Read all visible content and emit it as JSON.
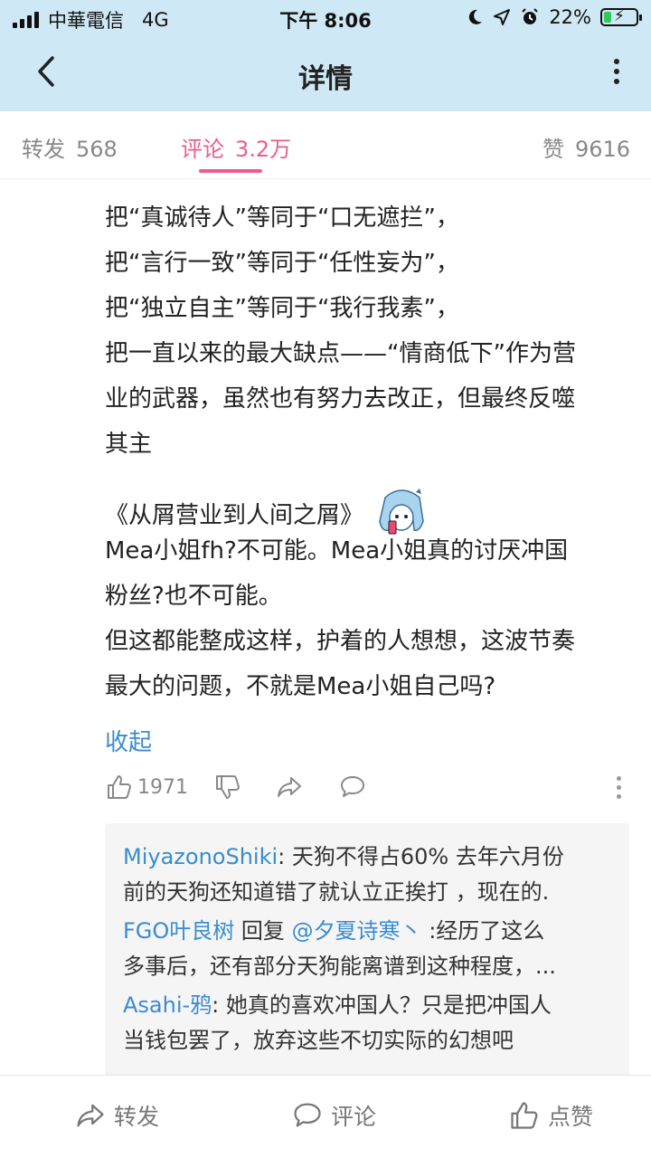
{
  "status": {
    "carrier": "中華電信",
    "network": "4G",
    "time": "下午 8:06",
    "battery": "22%",
    "battery_level": 0.22
  },
  "nav": {
    "title": "详情"
  },
  "tabs": {
    "repost": {
      "label": "转发",
      "count": "568"
    },
    "comment": {
      "label": "评论",
      "count": "3.2万"
    },
    "like": {
      "label": "赞",
      "count": "9616"
    }
  },
  "comment": {
    "lines": [
      "把“真诚待人”等同于“口无遮拦”，",
      "把“言行一致”等同于“任性妄为”，",
      "把“独立自主”等同于“我行我素”，",
      "把一直以来的最大缺点——“情商低下”作为营",
      "业的武器，虽然也有努力去改正，但最终反噬",
      "其主"
    ],
    "book_title": "《从屑营业到人间之屑》",
    "lines2": [
      "Mea小姐fh?不可能。Mea小姐真的讨厌冲国",
      "粉丝?也不可能。",
      "但这都能整成这样，护着的人想想，这波节奏",
      "最大的问题，不就是Mea小姐自己吗?"
    ],
    "collapse_label": "收起",
    "like_count": "1971"
  },
  "replies": [
    {
      "user": "MiyazonoShiki",
      "sep": ": ",
      "text_line1": "天狗不得占60%  去年六月份",
      "text_line2": "前的天狗还知道错了就认立正挨打 ，现在的."
    },
    {
      "user": "FGO叶良树",
      "reply_word": " 回复 ",
      "mention": "@夕夏诗寒丶",
      "text_line1": " :经历了这么",
      "text_line2": "多事后，还有部分天狗能离谱到这种程度，..."
    },
    {
      "user": "Asahi-鸦",
      "sep": ": ",
      "text_line1": "她真的喜欢冲国人？只是把冲国人",
      "text_line2": "当钱包罢了，放弃这些不切实际的幻想吧"
    }
  ],
  "bottombar": {
    "repost": "转发",
    "comment": "评论",
    "like": "点赞"
  },
  "colors": {
    "header_bg": "#cfe8f5",
    "accent_pink": "#ea5d8c",
    "link_blue": "#3a8ccf"
  }
}
